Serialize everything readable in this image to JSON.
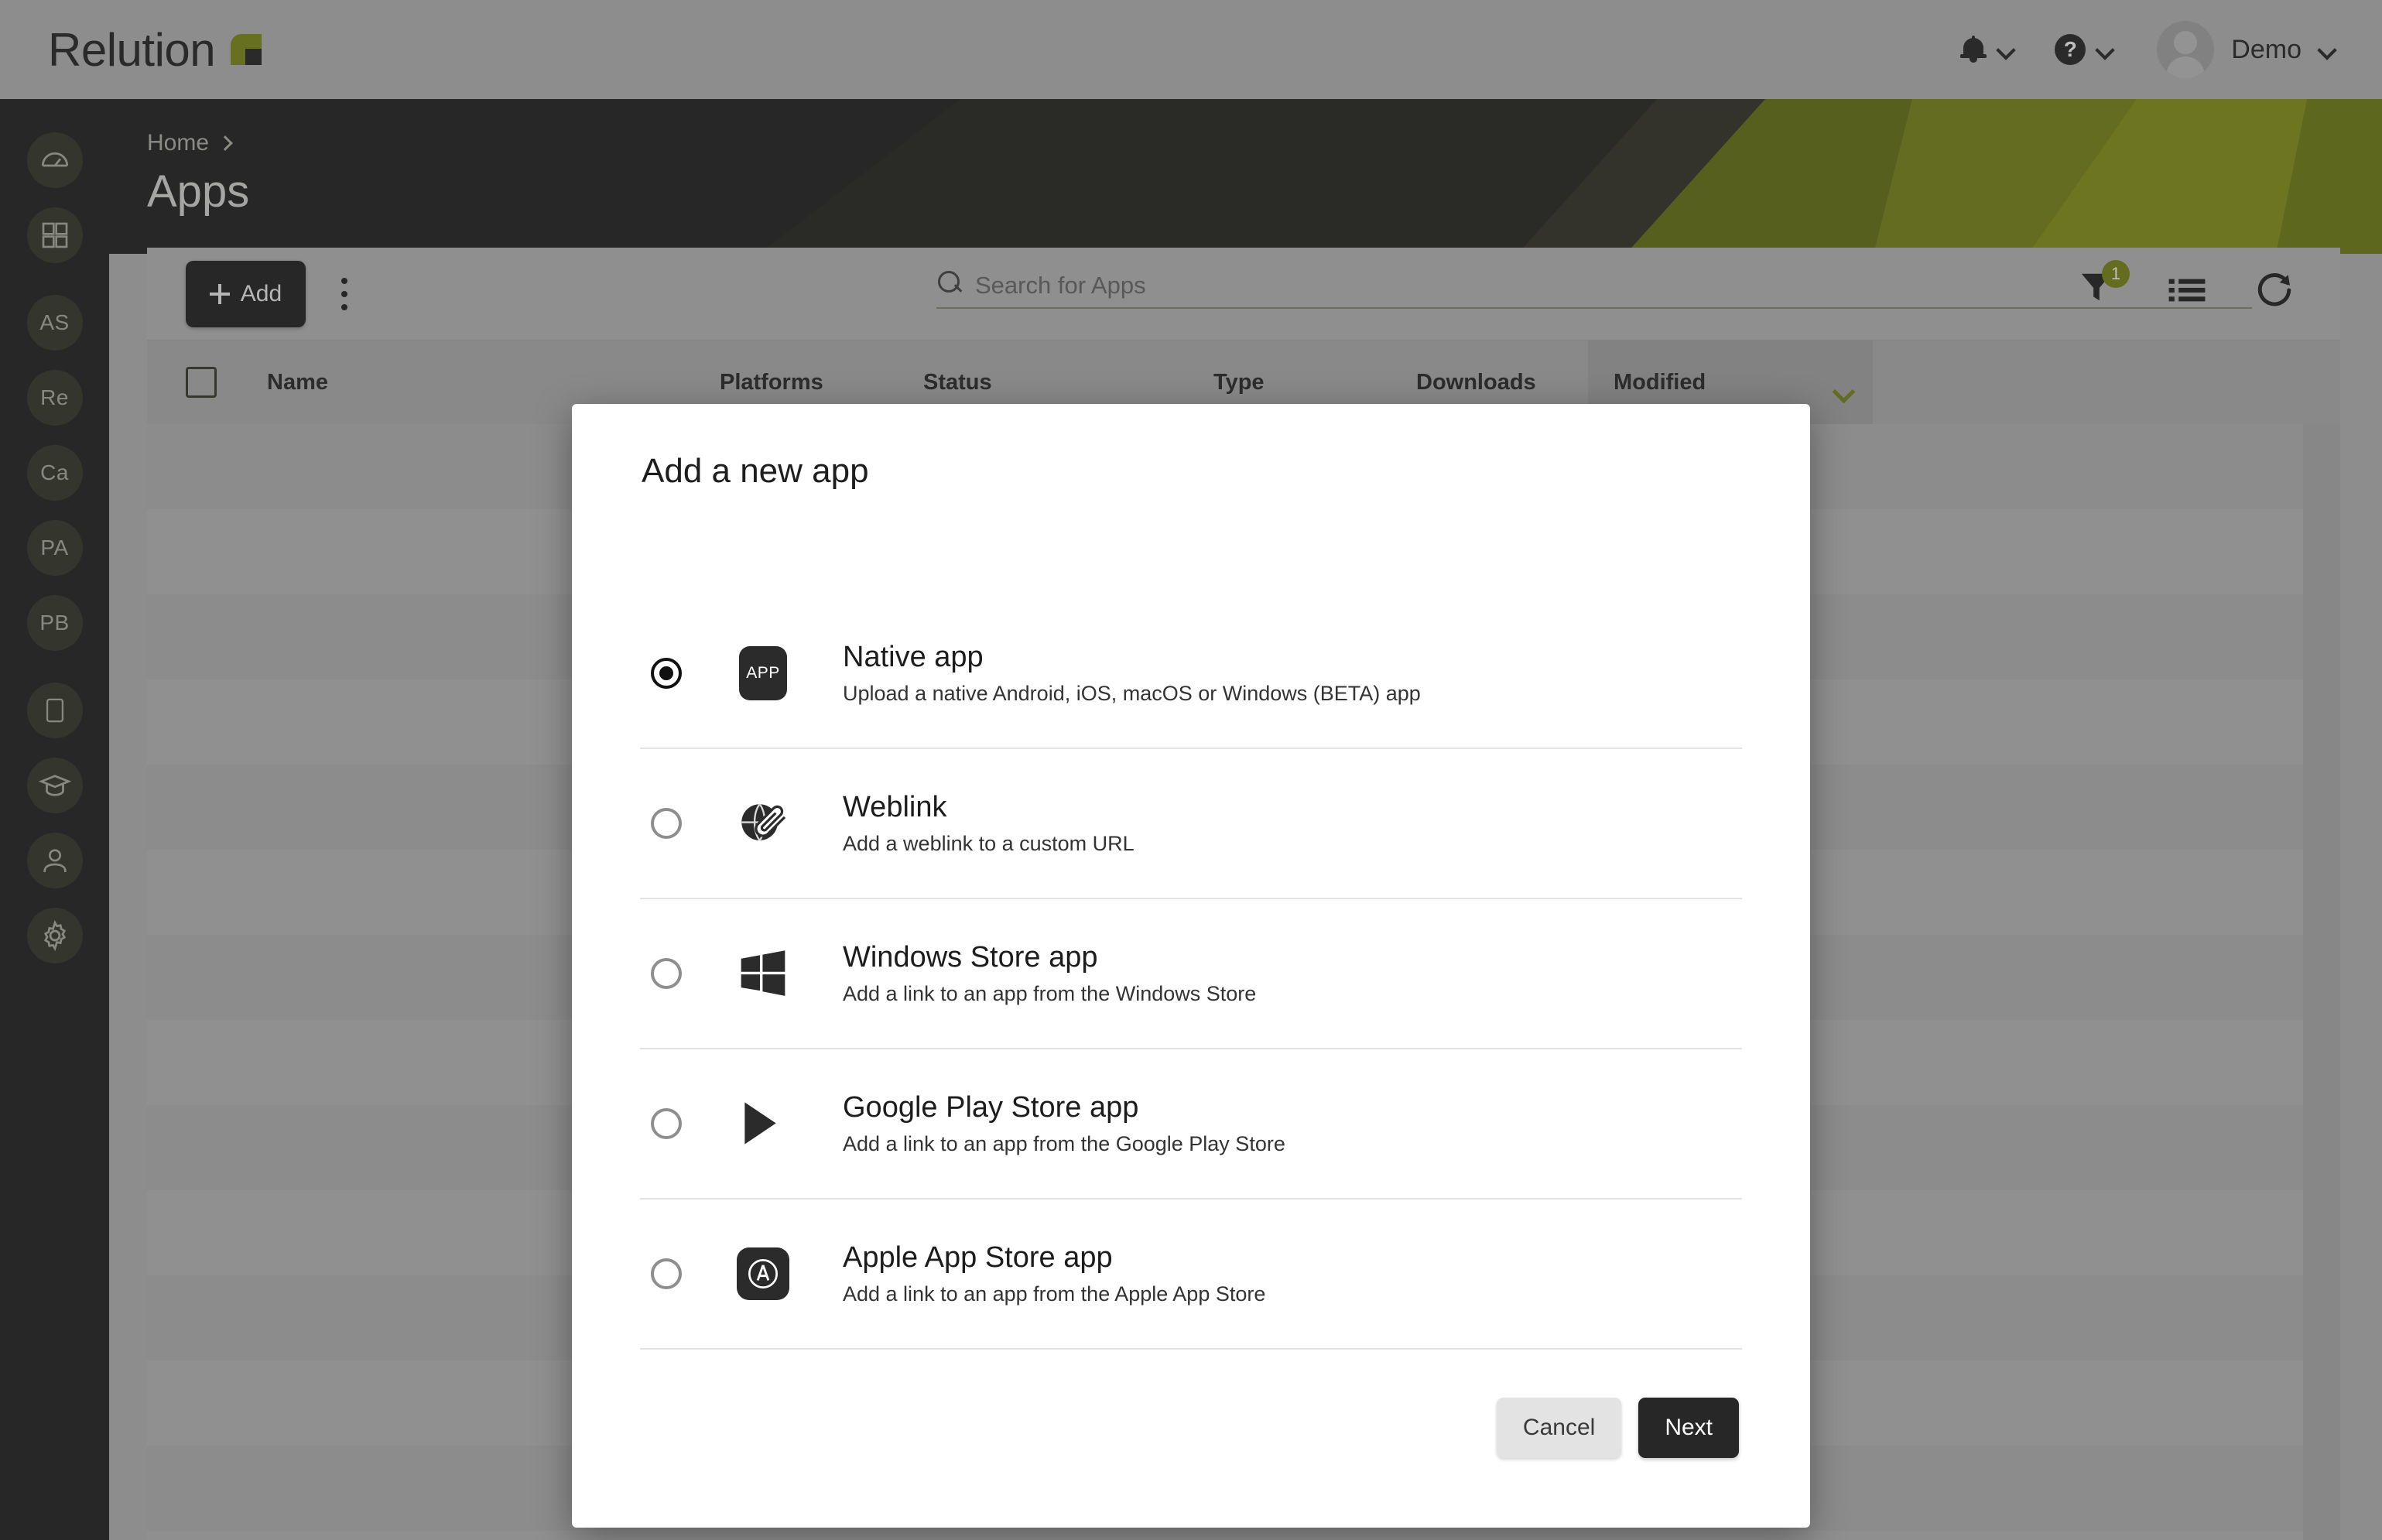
{
  "brand": {
    "name": "Relution",
    "mark_color": "#82901d"
  },
  "topbar": {
    "notifications_icon": "bell-icon",
    "help_icon": "question-mark-icon",
    "user_name": "Demo"
  },
  "sidebar": {
    "items": [
      {
        "id": "dashboard",
        "icon": "speedometer-icon",
        "label": "",
        "active": true
      },
      {
        "id": "apps",
        "icon": "grid-icon",
        "label": "",
        "active": true
      },
      {
        "id": "as",
        "icon": "",
        "label": "AS",
        "active": true
      },
      {
        "id": "re",
        "icon": "",
        "label": "Re",
        "active": true
      },
      {
        "id": "ca",
        "icon": "",
        "label": "Ca",
        "active": true
      },
      {
        "id": "pa",
        "icon": "",
        "label": "PA",
        "active": true
      },
      {
        "id": "pb",
        "icon": "",
        "label": "PB",
        "active": true
      },
      {
        "id": "devices",
        "icon": "tablet-icon",
        "label": "",
        "active": true
      },
      {
        "id": "education",
        "icon": "graduation-cap-icon",
        "label": "",
        "active": true
      },
      {
        "id": "users",
        "icon": "person-icon",
        "label": "",
        "active": true
      },
      {
        "id": "settings",
        "icon": "gear-icon",
        "label": "",
        "active": true
      }
    ]
  },
  "breadcrumb": {
    "home": "Home"
  },
  "page": {
    "title": "Apps"
  },
  "toolbar": {
    "add_label": "Add",
    "overflow_icon": "kebab-menu-icon",
    "filter_badge": "1",
    "filter_icon": "funnel-icon",
    "view_icon": "list-view-icon",
    "refresh_icon": "refresh-icon"
  },
  "search": {
    "value": "",
    "placeholder": "Search for Apps",
    "icon": "search-icon"
  },
  "table": {
    "columns": [
      "Name",
      "Platforms",
      "Status",
      "Type",
      "Downloads",
      "Modified"
    ],
    "sorted_column": "Modified",
    "sort_icon": "chevron-down-icon",
    "rows": []
  },
  "dialog": {
    "title": "Add a new app",
    "options": [
      {
        "id": "native-app",
        "label": "Native app",
        "description": "Upload a native Android, iOS, macOS or Windows (BETA) app",
        "icon": "app-tile-icon",
        "selected": true
      },
      {
        "id": "weblink",
        "label": "Weblink",
        "description": "Add a weblink to a custom URL",
        "icon": "globe-paperclip-icon",
        "selected": false
      },
      {
        "id": "windows-store-app",
        "label": "Windows Store app",
        "description": "Add a link to an app from the Windows Store",
        "icon": "windows-logo-icon",
        "selected": false
      },
      {
        "id": "google-play-store-app",
        "label": "Google Play Store app",
        "description": "Add a link to an app from the Google Play Store",
        "icon": "google-play-icon",
        "selected": false
      },
      {
        "id": "apple-app-store-app",
        "label": "Apple App Store app",
        "description": "Add a link to an app from the Apple App Store",
        "icon": "apple-app-store-icon",
        "selected": false
      }
    ],
    "cancel_label": "Cancel",
    "next_label": "Next"
  },
  "colors": {
    "accent_green": "#82901d",
    "dark": "#272727",
    "chrome_gray": "#b9b9b9"
  }
}
